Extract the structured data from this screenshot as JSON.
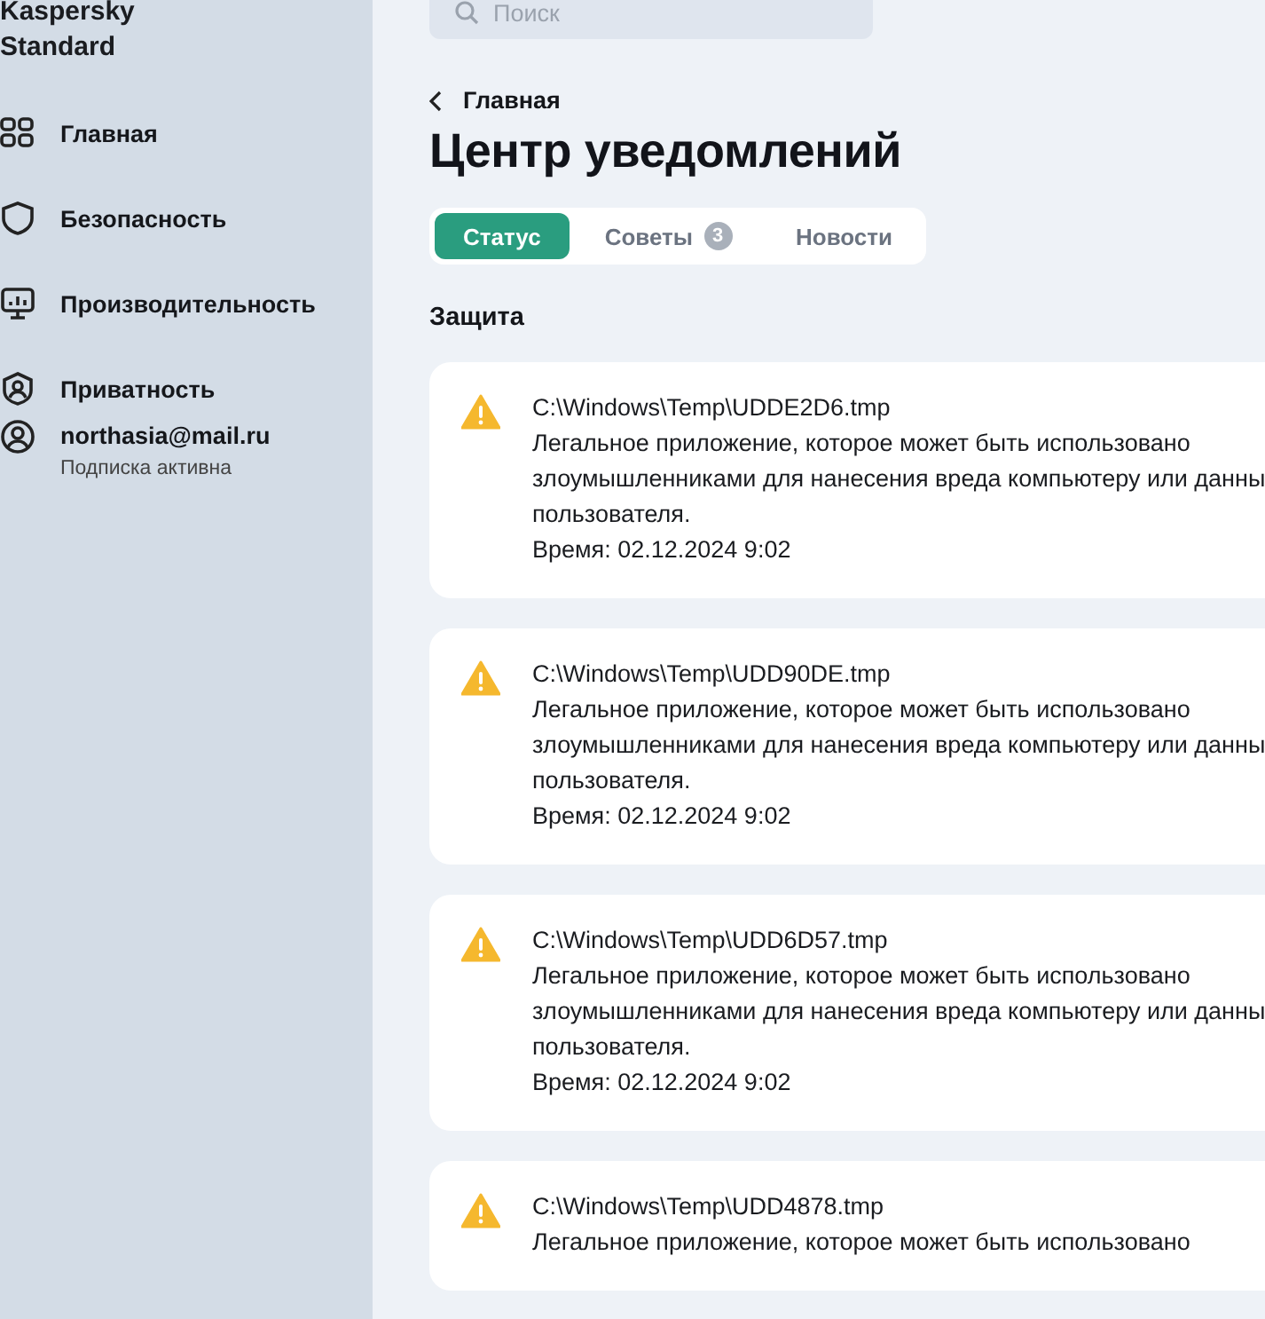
{
  "app": {
    "title": "Kaspersky Standard"
  },
  "sidebar": {
    "items": [
      {
        "label": "Главная",
        "selected": false
      },
      {
        "label": "Безопасность",
        "selected": false
      },
      {
        "label": "Производительность",
        "selected": false
      },
      {
        "label": "Приватность",
        "selected": false
      }
    ],
    "account": {
      "email": "northasia@mail.ru",
      "subscription": "Подписка активна"
    }
  },
  "search": {
    "placeholder": "Поиск"
  },
  "breadcrumb": "Главная",
  "title": "Центр уведомлений",
  "tabs": [
    {
      "label": "Статус",
      "selected": true
    },
    {
      "label": "Советы",
      "badge": "3",
      "selected": false
    },
    {
      "label": "Новости",
      "selected": false
    }
  ],
  "section": "Защита",
  "notifications": [
    {
      "path": "C:\\Windows\\Temp\\UDDE2D6.tmp",
      "lines": [
        "Легальное приложение, которое может быть использовано",
        "злоумышленниками для нанесения вреда компьютеру или данны",
        "пользователя."
      ],
      "time": "Время: 02.12.2024 9:02"
    },
    {
      "path": "C:\\Windows\\Temp\\UDD90DE.tmp",
      "lines": [
        "Легальное приложение, которое может быть использовано",
        "злоумышленниками для нанесения вреда компьютеру или данны",
        "пользователя."
      ],
      "time": "Время: 02.12.2024 9:02"
    },
    {
      "path": "C:\\Windows\\Temp\\UDD6D57.tmp",
      "lines": [
        "Легальное приложение, которое может быть использовано",
        "злоумышленниками для нанесения вреда компьютеру или данны",
        "пользователя."
      ],
      "time": "Время: 02.12.2024 9:02"
    },
    {
      "path": "C:\\Windows\\Temp\\UDD4878.tmp",
      "lines": [
        "Легальное приложение, которое может быть использовано"
      ]
    }
  ]
}
